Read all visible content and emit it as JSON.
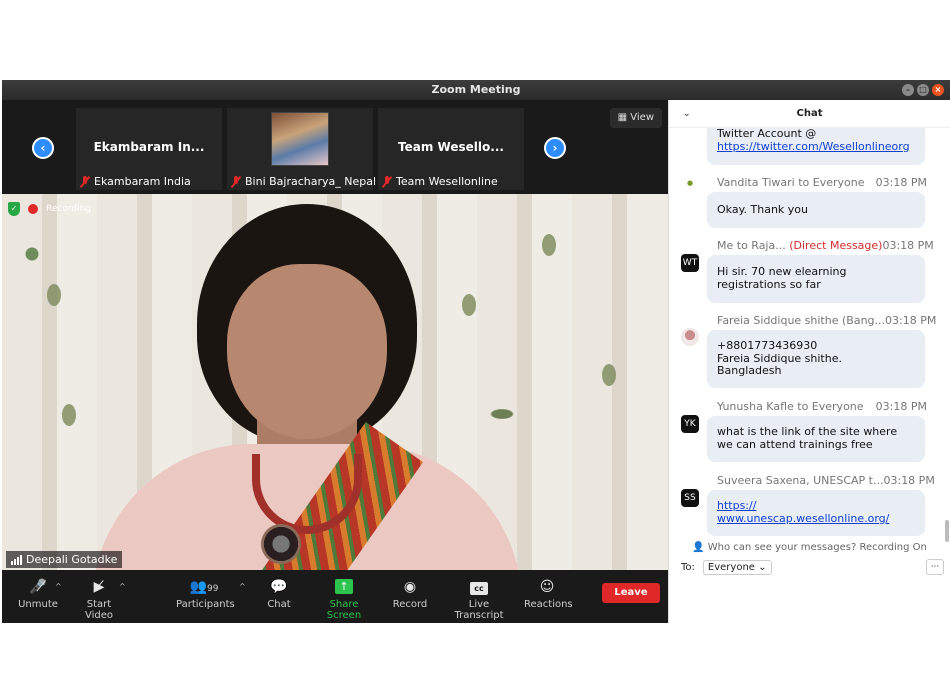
{
  "window": {
    "title": "Zoom Meeting",
    "controls": [
      "–",
      "□",
      "×"
    ]
  },
  "thumbnails": {
    "prev_arrow": "‹",
    "next_arrow": "›",
    "view_label": "View",
    "tiles": [
      {
        "name": "Ekambaram In...",
        "label": "Ekambaram India"
      },
      {
        "name": "",
        "label": "Bini Bajracharya_ Nepal"
      },
      {
        "name": "Team Wesello...",
        "label": "Team Wesellonline"
      }
    ]
  },
  "video": {
    "recording_label": "Recording",
    "speaker_name": "Deepali Gotadke"
  },
  "toolbar": {
    "unmute": "Unmute",
    "start_video": "Start Video",
    "participants": "Participants",
    "participants_count": "99",
    "chat": "Chat",
    "share_screen": "Share Screen",
    "record": "Record",
    "live_transcript": "Live Transcript",
    "reactions": "Reactions",
    "leave": "Leave",
    "cc_icon_text": "cc"
  },
  "chat": {
    "title": "Chat",
    "messages": [
      {
        "sender": "",
        "time": "",
        "text_lines": [
          "Twitter Account @"
        ],
        "link": "https://twitter.com/Wesellonlineorg"
      },
      {
        "sender": "Vandita Tiwari to Everyone",
        "time": "03:18 PM",
        "text": "Okay. Thank you"
      },
      {
        "sender": "Me to Raja...",
        "dm": "(Direct Message)",
        "time": "03:18 PM",
        "avatar": "WT",
        "text": "Hi sir. 70 new elearning registrations so far"
      },
      {
        "sender": "Fareia Siddique shithe (Bang...",
        "time": "03:18 PM",
        "text_lines": [
          "+8801773436930",
          "Fareia Siddique shithe.",
          "Bangladesh"
        ]
      },
      {
        "sender": "Yunusha Kafle to Everyone",
        "time": "03:18 PM",
        "avatar": "YK",
        "text": "what is the link of the site where we can attend trainings free"
      },
      {
        "sender": "Suveera Saxena, UNESCAP t...",
        "time": "03:18 PM",
        "avatar": "SS",
        "link_lines": [
          "https://",
          "www.unescap.wesellonline.org/"
        ]
      }
    ],
    "who_can_see": "Who can see your messages? Recording On",
    "to_label": "To:",
    "to_value": "Everyone",
    "more_label": "···"
  }
}
